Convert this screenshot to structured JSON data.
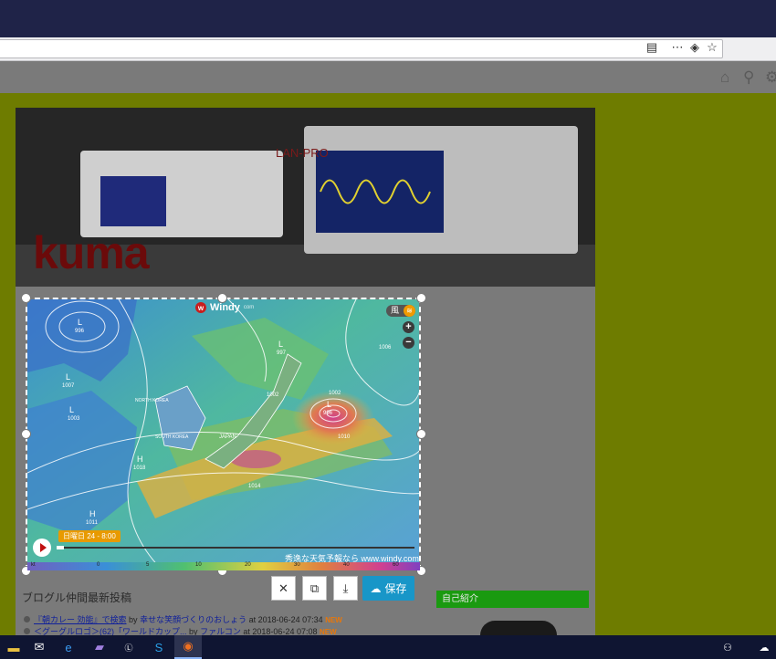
{
  "browser": {
    "toolbar_icons": [
      "reader-icon",
      "more-icon",
      "pocket-icon",
      "bookmark-star-icon"
    ]
  },
  "site": {
    "banner": {
      "logo_text": "kuma",
      "subtitle": "LAN-PRO"
    },
    "header_icons": [
      "home-icon",
      "search-icon",
      "gear-icon"
    ]
  },
  "map_widget": {
    "brand": "Windy",
    "brand_suffix": "com",
    "layer_label": "風",
    "zoom_in": "+",
    "zoom_out": "−",
    "date_label": "日曜日 24 - 8:00",
    "timeline_progress": 0.02,
    "attribution": "秀逸な天気予報なら www.windy.com",
    "scale": {
      "unit": "kt",
      "ticks": [
        "0",
        "5",
        "10",
        "20",
        "30",
        "40",
        "60"
      ]
    },
    "pressure_centers": [
      {
        "type": "L",
        "value": "996"
      },
      {
        "type": "L",
        "value": "1007"
      },
      {
        "type": "L",
        "value": "1003"
      },
      {
        "type": "H",
        "value": "1018"
      },
      {
        "type": "H",
        "value": "1011"
      },
      {
        "type": "L",
        "value": "997"
      },
      {
        "type": "L",
        "value": "996"
      }
    ],
    "isobar_labels": [
      "1006",
      "1002",
      "1002",
      "1010",
      "1014"
    ],
    "place_labels": [
      "NORTH KOREA",
      "SOUTH KOREA",
      "JAPAN"
    ]
  },
  "capture_controls": {
    "close": "✕",
    "copy": "⧉",
    "download": "⤓",
    "save": "保存"
  },
  "sidebar": {
    "profile_title": "自己紹介"
  },
  "blog": {
    "section_title": "ブログル仲間最新投稿",
    "posts": [
      {
        "title": "『朝カレー 効能』で検索",
        "by": "by",
        "author": "幸せな笑顔づくりのおしょう",
        "at": "at 2018-06-24 07:34",
        "badge": "NEW"
      },
      {
        "title": "＜グーグルロゴ＞(62)「ワールドカップ...",
        "by": "by",
        "author": "ファルコン",
        "at": "at 2018-06-24 07:08",
        "badge": "NEW"
      }
    ]
  },
  "taskbar": {
    "apps": [
      "file-explorer-icon",
      "mail-icon",
      "edge-icon",
      "app-icon",
      "livewriter-icon",
      "skype-icon",
      "firefox-icon"
    ],
    "active": "firefox-icon",
    "tray": [
      "people-icon",
      "cloud-icon"
    ]
  },
  "colors": {
    "page_bg": "#6e7c00",
    "titlebar": "#1f2348",
    "save_button": "#1896c8",
    "profile_header": "#1a9a10",
    "new_badge": "#e8770a"
  }
}
